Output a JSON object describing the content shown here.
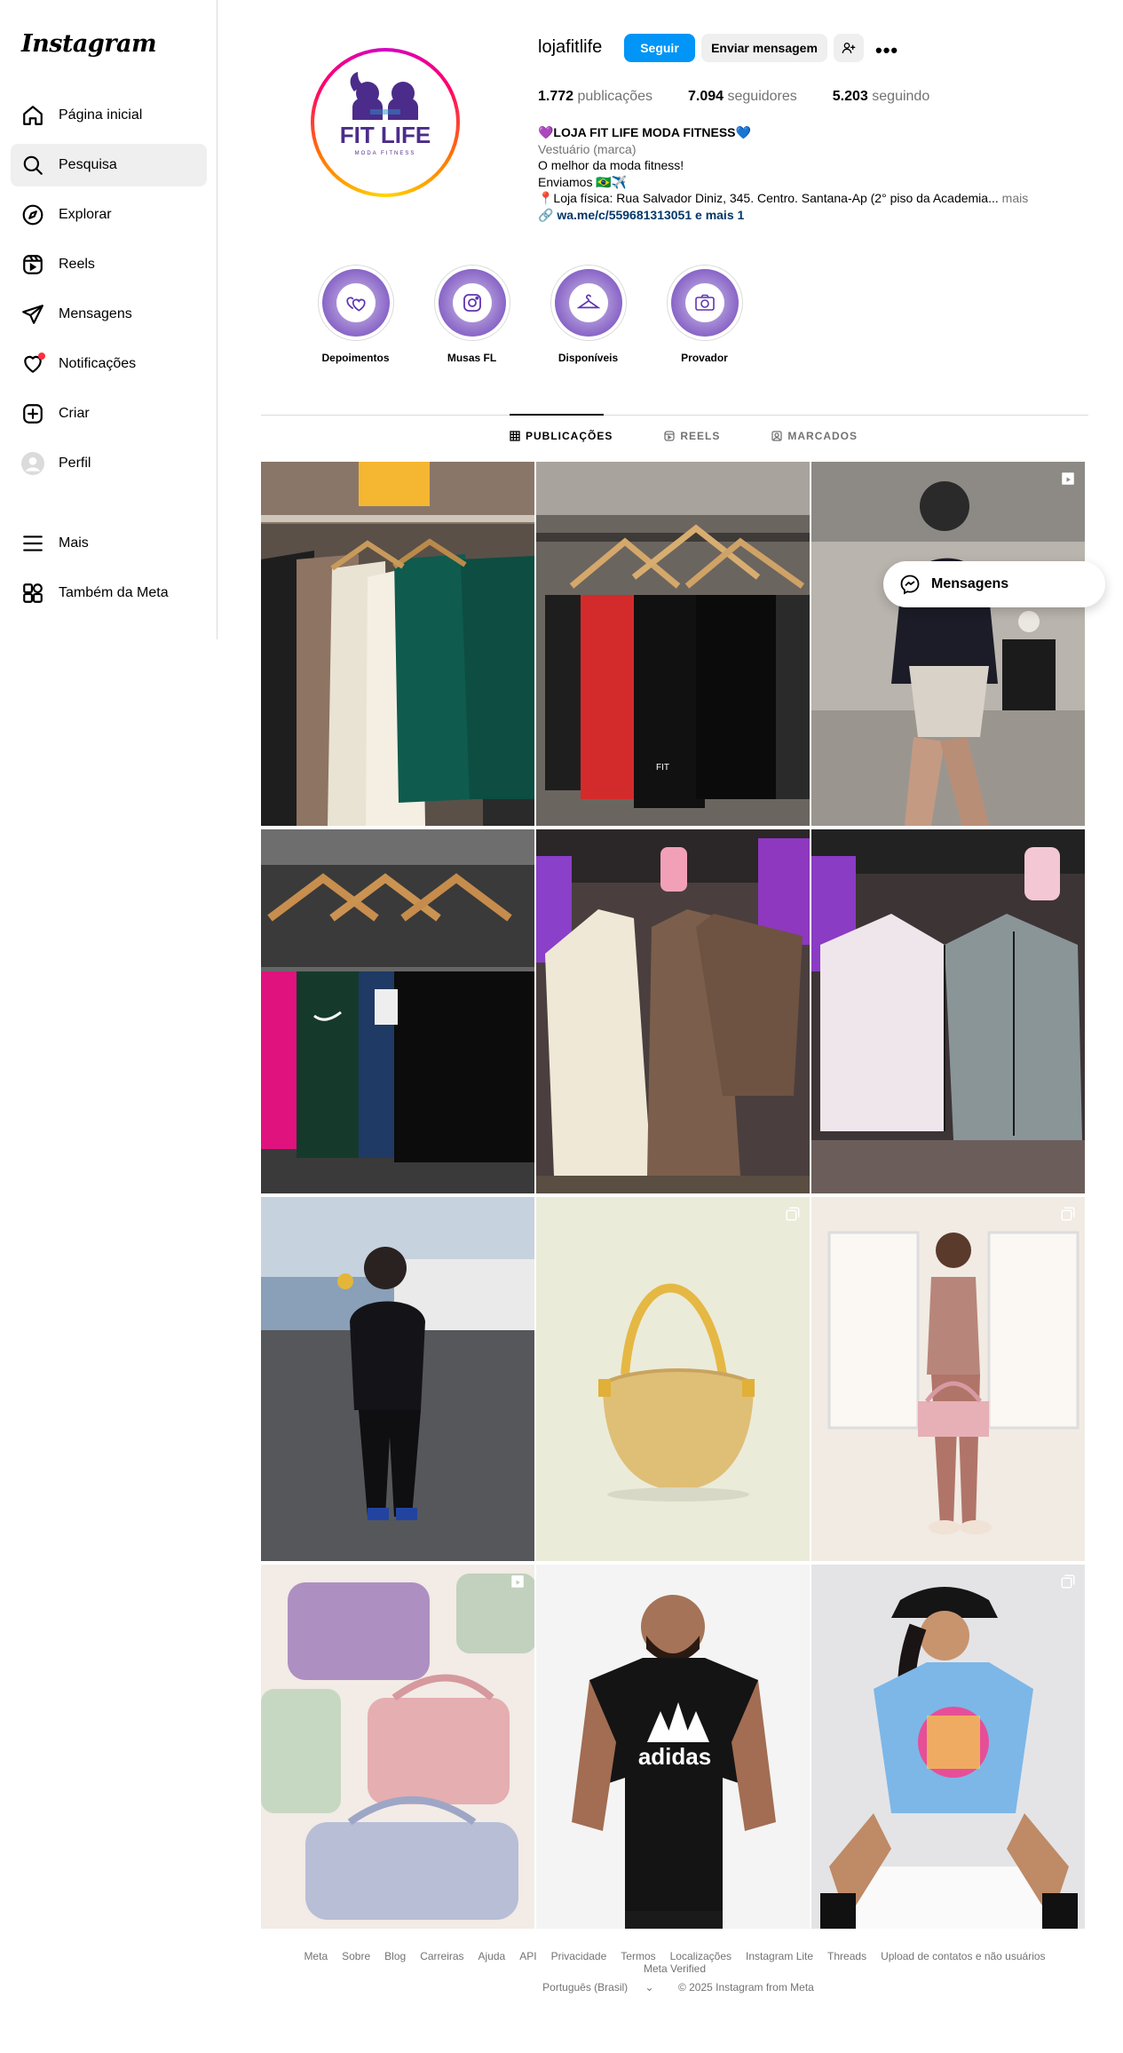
{
  "app": {
    "logo": "Instagram"
  },
  "sidebar": {
    "items": [
      {
        "label": "Página inicial",
        "icon": "home-icon"
      },
      {
        "label": "Pesquisa",
        "icon": "search-icon",
        "active": true
      },
      {
        "label": "Explorar",
        "icon": "compass-icon"
      },
      {
        "label": "Reels",
        "icon": "reels-icon"
      },
      {
        "label": "Mensagens",
        "icon": "send-icon"
      },
      {
        "label": "Notificações",
        "icon": "heart-icon"
      },
      {
        "label": "Criar",
        "icon": "plus-square-icon"
      },
      {
        "label": "Perfil",
        "icon": "avatar-icon"
      }
    ],
    "bottom_items": [
      {
        "label": "Mais",
        "icon": "menu-icon"
      },
      {
        "label": "Também da Meta",
        "icon": "meta-apps-icon"
      }
    ]
  },
  "profile": {
    "username": "lojafitlife",
    "follow_label": "Seguir",
    "message_label": "Enviar mensagem",
    "avatar_text": "FIT LIFE",
    "avatar_subtext": "MODA FITNESS",
    "stats": {
      "posts_count": "1.772",
      "posts_label": "publicações",
      "followers_count": "7.094",
      "followers_label": "seguidores",
      "following_count": "5.203",
      "following_label": "seguindo"
    },
    "bio": {
      "name": "💜LOJA FIT LIFE MODA FITNESS💙",
      "category": "Vestuário (marca)",
      "line1": "O melhor da moda fitness!",
      "line2": "Enviamos 🇧🇷✈️",
      "line3": "📍Loja física: Rua Salvador Diniz, 345. Centro. Santana-Ap (2° piso da Academia...",
      "more": "mais",
      "link": "wa.me/c/559681313051 e mais 1"
    }
  },
  "highlights": [
    {
      "label": "Depoimentos",
      "icon": "hearts-icon"
    },
    {
      "label": "Musas FL",
      "icon": "instagram-icon"
    },
    {
      "label": "Disponíveis",
      "icon": "hanger-icon"
    },
    {
      "label": "Provador",
      "icon": "camera-icon"
    }
  ],
  "tabs": [
    {
      "label": "PUBLICAÇÕES",
      "active": true
    },
    {
      "label": "REELS"
    },
    {
      "label": "MARCADOS"
    }
  ],
  "floating_messages": {
    "label": "Mensagens"
  },
  "footer": {
    "links": [
      "Meta",
      "Sobre",
      "Blog",
      "Carreiras",
      "Ajuda",
      "API",
      "Privacidade",
      "Termos",
      "Localizações",
      "Instagram Lite",
      "Threads",
      "Upload de contatos e não usuários",
      "Meta Verified"
    ],
    "language": "Português (Brasil)",
    "copyright": "© 2025 Instagram from Meta"
  },
  "colors": {
    "accent": "#0095f6",
    "notification": "#ff3040",
    "link": "#00376b"
  }
}
